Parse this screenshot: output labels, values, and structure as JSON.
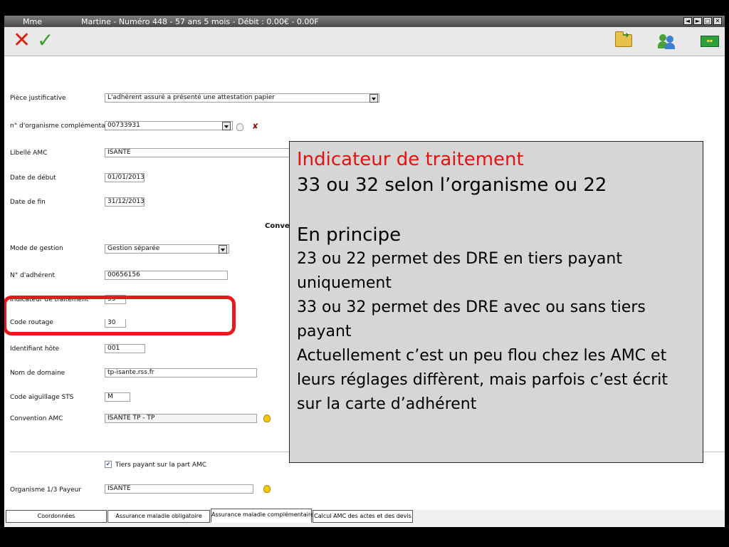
{
  "window": {
    "title_left": "Mme",
    "title_main": "Martine  - Numéro 448   -   57 ans 5 mois  - Débit : 0.00€ - 0.00F",
    "window_buttons": [
      "◄",
      "►",
      "□",
      "✕"
    ]
  },
  "toolbar": {
    "cancel_icon": "red-x-icon",
    "validate_icon": "green-check-icon",
    "folder_icon": "folder-icon",
    "users_icon": "users-icon",
    "card_icon": "vitale-card-icon"
  },
  "form": {
    "piece_justificative": {
      "label": "Pièce justificative",
      "value": "L'adhérent assuré a présenté une attestation papier"
    },
    "organisme": {
      "label": "n° d'organisme complémentaire",
      "value": "00733931"
    },
    "libelle_amc": {
      "label": "Libellé AMC",
      "value": "ISANTÉ"
    },
    "date_debut": {
      "label": "Date de début",
      "value": "01/01/2013"
    },
    "date_fin": {
      "label": "Date de fin",
      "value": "31/12/2013"
    },
    "section_label": "Conven",
    "mode_gestion": {
      "label": "Mode de gestion",
      "value": "Gestion séparée"
    },
    "num_adherent": {
      "label": "N° d'adhérent",
      "value": "00656156"
    },
    "indicateur": {
      "label": "Indicateur de traitement",
      "value": "33"
    },
    "code_routage": {
      "label": "Code routage",
      "value": "30"
    },
    "identifiant_hote": {
      "label": "Identifiant hôte",
      "value": "001"
    },
    "nom_domaine": {
      "label": "Nom de domaine",
      "value": "tp-isante.rss.fr"
    },
    "code_aiguillage": {
      "label": "Code aiguillage STS",
      "value": "M"
    },
    "convention_amc": {
      "label": "Convention AMC",
      "value": "ISANTE TP - TP"
    },
    "tiers_payant": {
      "label": "Tiers payant sur la part AMC",
      "checked": true
    },
    "organisme_payeur": {
      "label": "Organisme 1/3 Payeur",
      "value": "ISANTE"
    }
  },
  "tabs": [
    {
      "label": "Coordonnées",
      "active": false
    },
    {
      "label": "Assurance maladie obligatoire",
      "active": false
    },
    {
      "label": "Assurance maladie complémentaire",
      "active": true
    },
    {
      "label": "Calcul AMC des actes et des devis",
      "active": false
    }
  ],
  "annotation": {
    "title": "Indicateur de traitement",
    "subtitle": "33 ou 32 selon l’organisme ou 22",
    "heading": "En principe",
    "line1": "23 ou 22 permet des DRE en tiers payant uniquement",
    "line2": "33 ou 32 permet des DRE avec ou sans tiers payant",
    "line3": "Actuellement c’est un peu flou chez les AMC et leurs réglages diffèrent, mais parfois c’est écrit sur la carte d’adhérent",
    "title_color": "#e8110f",
    "highlight_color": "#e51b1b"
  }
}
